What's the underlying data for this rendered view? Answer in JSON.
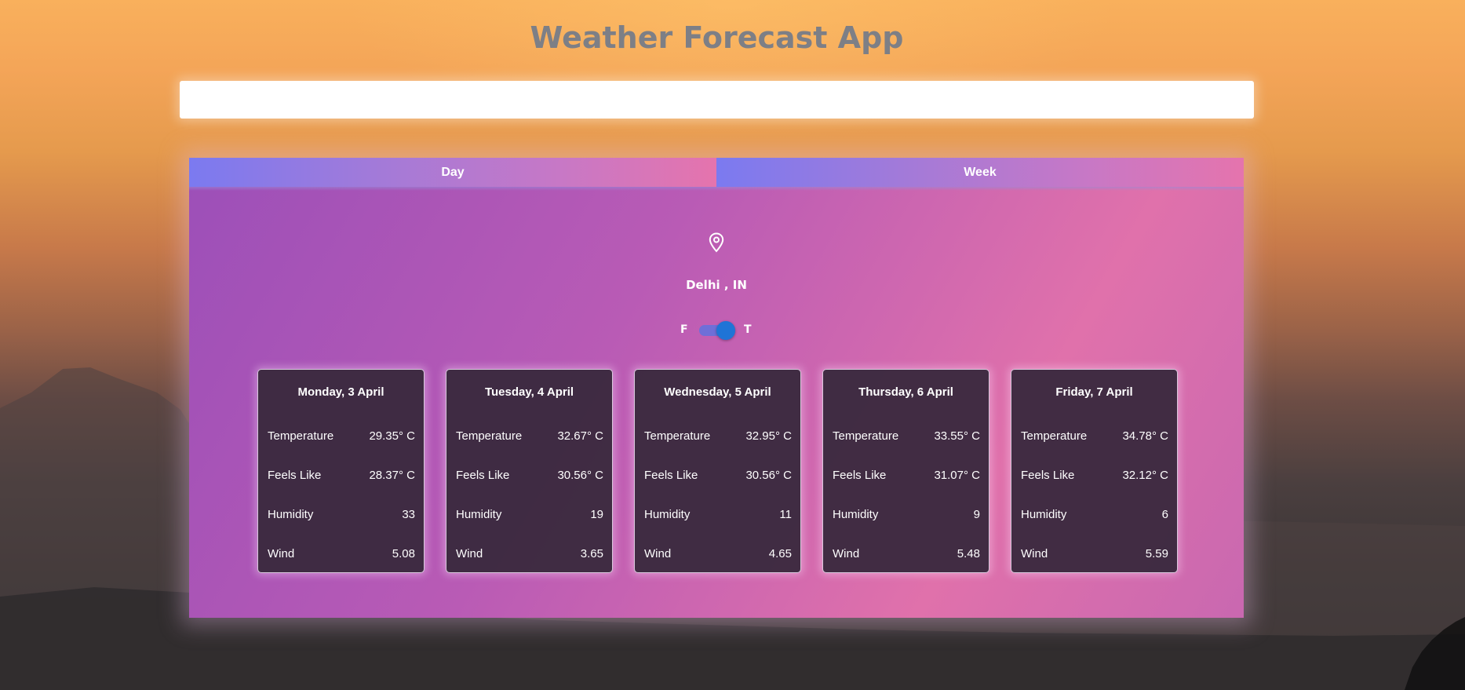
{
  "app": {
    "title": "Weather Forecast App"
  },
  "search": {
    "value": "",
    "placeholder": ""
  },
  "tabs": [
    {
      "label": "Day"
    },
    {
      "label": "Week"
    }
  ],
  "location": {
    "icon": "map-pin-icon",
    "label": "Delhi , IN"
  },
  "unit_toggle": {
    "left_label": "F",
    "right_label": "T",
    "state": "on"
  },
  "forecast": [
    {
      "date": "Monday, 3 April",
      "rows": [
        {
          "label": "Temperature",
          "value": "29.35° C"
        },
        {
          "label": "Feels Like",
          "value": "28.37° C"
        },
        {
          "label": "Humidity",
          "value": "33"
        },
        {
          "label": "Wind",
          "value": "5.08"
        }
      ]
    },
    {
      "date": "Tuesday, 4 April",
      "rows": [
        {
          "label": "Temperature",
          "value": "32.67° C"
        },
        {
          "label": "Feels Like",
          "value": "30.56° C"
        },
        {
          "label": "Humidity",
          "value": "19"
        },
        {
          "label": "Wind",
          "value": "3.65"
        }
      ]
    },
    {
      "date": "Wednesday, 5 April",
      "rows": [
        {
          "label": "Temperature",
          "value": "32.95° C"
        },
        {
          "label": "Feels Like",
          "value": "30.56° C"
        },
        {
          "label": "Humidity",
          "value": "11"
        },
        {
          "label": "Wind",
          "value": "4.65"
        }
      ]
    },
    {
      "date": "Thursday, 6 April",
      "rows": [
        {
          "label": "Temperature",
          "value": "33.55° C"
        },
        {
          "label": "Feels Like",
          "value": "31.07° C"
        },
        {
          "label": "Humidity",
          "value": "9"
        },
        {
          "label": "Wind",
          "value": "5.48"
        }
      ]
    },
    {
      "date": "Friday, 7 April",
      "rows": [
        {
          "label": "Temperature",
          "value": "34.78° C"
        },
        {
          "label": "Feels Like",
          "value": "32.12° C"
        },
        {
          "label": "Humidity",
          "value": "6"
        },
        {
          "label": "Wind",
          "value": "5.59"
        }
      ]
    }
  ],
  "colors": {
    "title": "#7d7f86",
    "toggle_knob": "#1f74d6",
    "toggle_track": "#6f6fd8",
    "card_background": "#3a2a3e",
    "panel_left": "#9c4fb8",
    "panel_right": "#e071ab"
  }
}
